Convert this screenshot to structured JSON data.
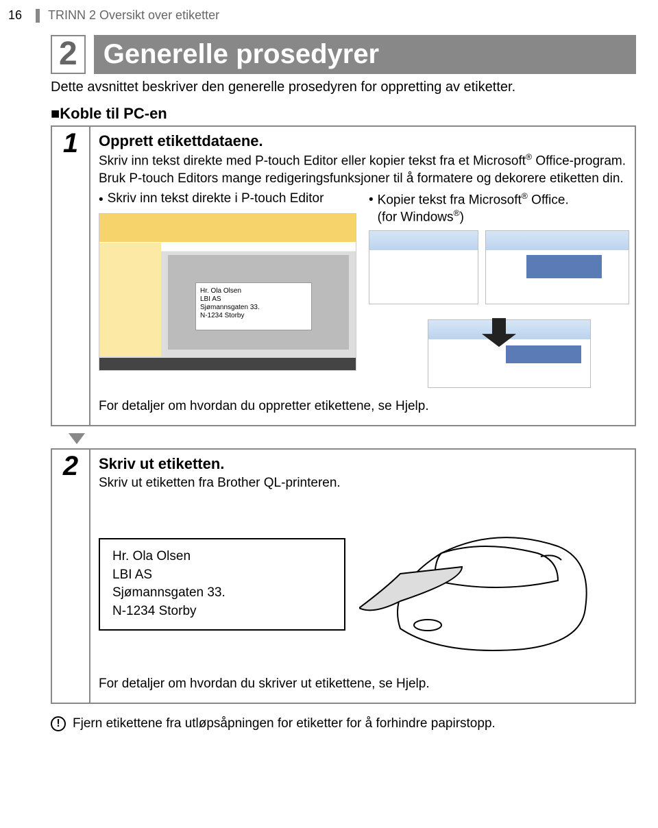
{
  "page_number": "16",
  "header": "TRINN 2 Oversikt over etiketter",
  "section_number": "2",
  "section_title": "Generelle prosedyrer",
  "intro": "Dette avsnittet beskriver den generelle prosedyren for oppretting av etiketter.",
  "subheading_prefix": "■",
  "subheading": "Koble til PC-en",
  "step1": {
    "num": "1",
    "title": "Opprett etikettdataene.",
    "line1a": "Skriv inn tekst direkte med P-touch Editor eller kopier tekst fra et Microsoft",
    "line1b": " Office-program.",
    "line2": "Bruk P-touch Editors mange redigeringsfunksjoner til å formatere og dekorere etiketten din.",
    "bullet_left": "Skriv inn tekst direkte i P-touch Editor",
    "bullet_right_a": "Kopier tekst fra Microsoft",
    "bullet_right_b": " Office.",
    "bullet_right_c": "(for Windows",
    "bullet_right_d": ")",
    "label_sample": {
      "l1": "Hr. Ola Olsen",
      "l2": "LBI AS",
      "l3": "Sjømannsgaten 33.",
      "l4": "N-1234 Storby"
    },
    "footer": "For detaljer om hvordan du oppretter etikettene, se Hjelp."
  },
  "step2": {
    "num": "2",
    "title": "Skriv ut etiketten.",
    "line1": "Skriv ut etiketten fra Brother QL-printeren.",
    "label_print": {
      "l1": "Hr. Ola Olsen",
      "l2": "LBI AS",
      "l3": "Sjømannsgaten 33.",
      "l4": "N-1234 Storby"
    },
    "footer": "For detaljer om hvordan du skriver ut etikettene, se Hjelp."
  },
  "warning": "Fjern etikettene fra utløpsåpningen for etiketter for å forhindre papirstopp.",
  "reg_mark": "®"
}
